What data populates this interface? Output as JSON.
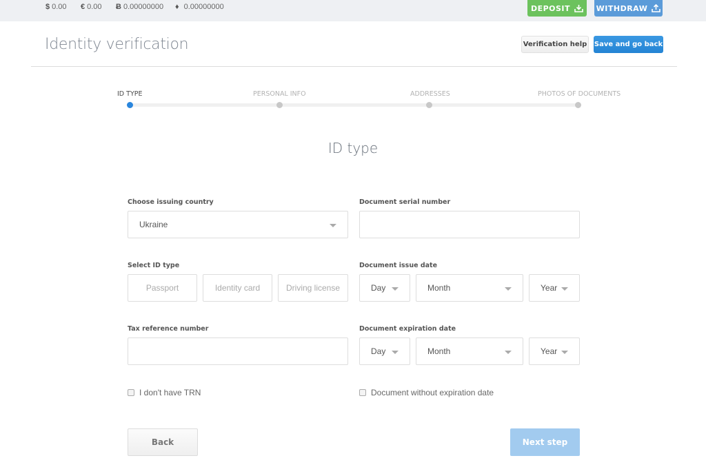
{
  "topbar": {
    "balances": [
      {
        "currency": "usd",
        "symbol": "$",
        "amount": "0.00"
      },
      {
        "currency": "eur",
        "symbol": "€",
        "amount": "0.00"
      },
      {
        "currency": "btc",
        "symbol": "Ƀ",
        "amount": "0.00000000"
      },
      {
        "currency": "eth",
        "symbol": "♦",
        "amount": "0.00000000"
      }
    ],
    "deposit_label": "DEPOSIT",
    "withdraw_label": "WITHDRAW",
    "deposit_color": "#6cc25d",
    "withdraw_color": "#5b9bd9"
  },
  "header": {
    "title": "Identity verification",
    "help_label": "Verification help",
    "save_label": "Save and go back"
  },
  "stepper": {
    "steps": [
      {
        "label": "ID TYPE",
        "active": true
      },
      {
        "label": "PERSONAL INFO",
        "active": false
      },
      {
        "label": "ADDRESSES",
        "active": false
      },
      {
        "label": "PHOTOS OF DOCUMENTS",
        "active": false
      }
    ],
    "active_color": "#2a86dd"
  },
  "form": {
    "title": "ID type",
    "country": {
      "label": "Choose issuing country",
      "value": "Ukraine"
    },
    "serial": {
      "label": "Document serial number",
      "value": ""
    },
    "id_type": {
      "label": "Select ID type",
      "options": [
        "Passport",
        "Identity card",
        "Driving license"
      ]
    },
    "issue_date": {
      "label": "Document issue date",
      "day": "Day",
      "month": "Month",
      "year": "Year"
    },
    "trn": {
      "label": "Tax reference number",
      "value": ""
    },
    "expiration_date": {
      "label": "Document expiration date",
      "day": "Day",
      "month": "Month",
      "year": "Year"
    },
    "no_trn_label": "I don't have TRN",
    "no_expiration_label": "Document without expiration date"
  },
  "footer": {
    "back_label": "Back",
    "next_label": "Next step"
  }
}
